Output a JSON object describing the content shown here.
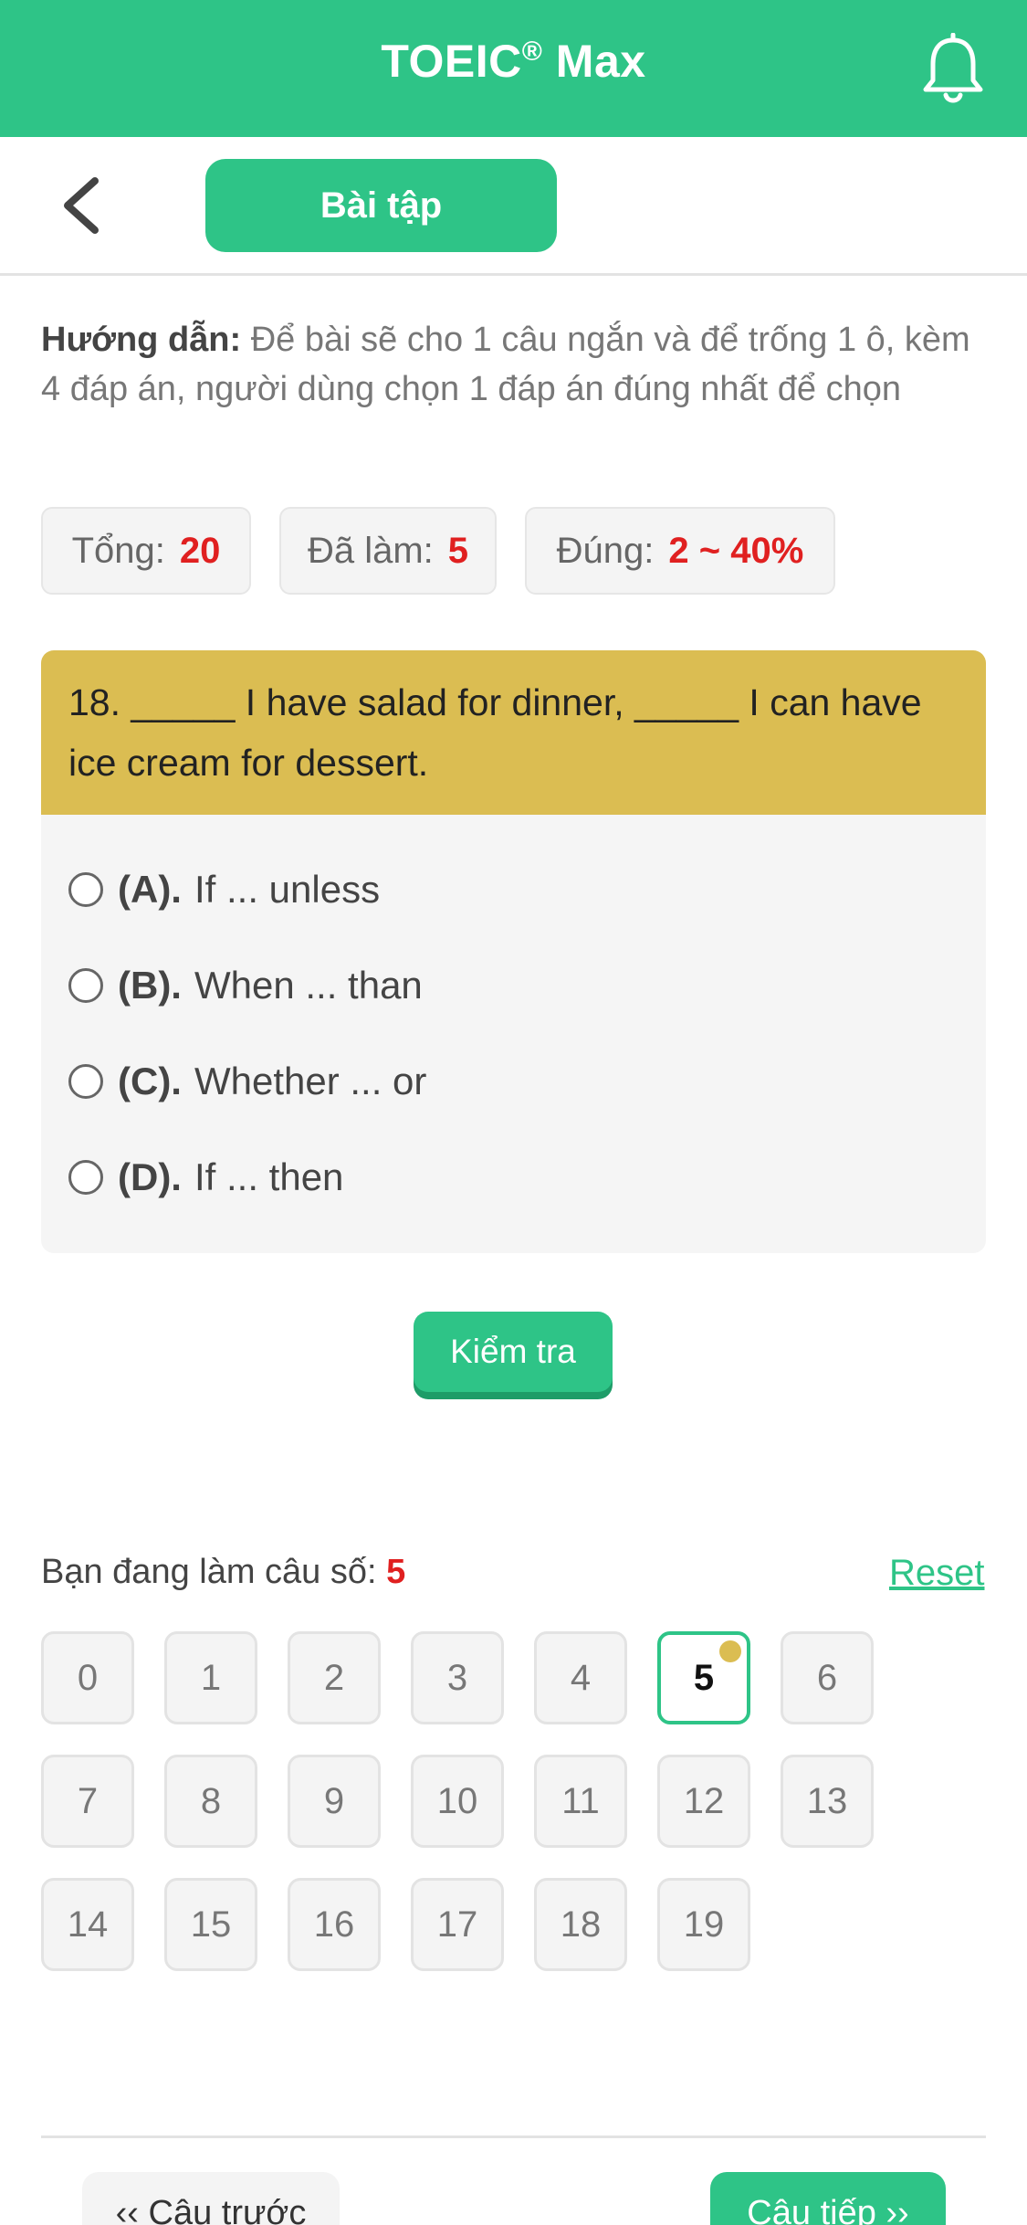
{
  "header": {
    "app_title": "TOEIC",
    "app_title_reg": "®",
    "app_title_suffix": " Max",
    "bell_icon": "bell-icon"
  },
  "subbar": {
    "back_icon": "chevron-left-icon",
    "tab_label": "Bài tập"
  },
  "guide": {
    "label": "Hướng dẫn:",
    "text": " Để bài sẽ cho 1 câu ngắn và để trống 1 ô, kèm 4 đáp án, người dùng chọn 1 đáp án đúng nhất để chọn"
  },
  "stats": {
    "total_label": "Tổng:",
    "total_value": "20",
    "done_label": "Đã làm:",
    "done_value": "5",
    "correct_label": "Đúng:",
    "correct_value": "2 ~ 40%"
  },
  "question": {
    "text": "18. _____ I have salad for dinner, _____ I can have ice cream for dessert.",
    "options": [
      {
        "label": "(A).",
        "text": "If ... unless"
      },
      {
        "label": "(B).",
        "text": "When ... than"
      },
      {
        "label": "(C).",
        "text": "Whether ... or"
      },
      {
        "label": "(D).",
        "text": "If ... then"
      }
    ]
  },
  "check_button": "Kiểm tra",
  "progress": {
    "current_label": "Bạn đang làm câu số:",
    "current_value": "5",
    "reset_label": "Reset",
    "questions": [
      "0",
      "1",
      "2",
      "3",
      "4",
      "5",
      "6",
      "7",
      "8",
      "9",
      "10",
      "11",
      "12",
      "13",
      "14",
      "15",
      "16",
      "17",
      "18",
      "19"
    ],
    "active_index": 5
  },
  "footer": {
    "prev_label": "‹‹ Câu trước",
    "next_label": "Câu tiếp ››"
  },
  "colors": {
    "brand_green": "#2ec487",
    "question_yellow": "#dbbd52",
    "accent_red": "#e02020"
  }
}
